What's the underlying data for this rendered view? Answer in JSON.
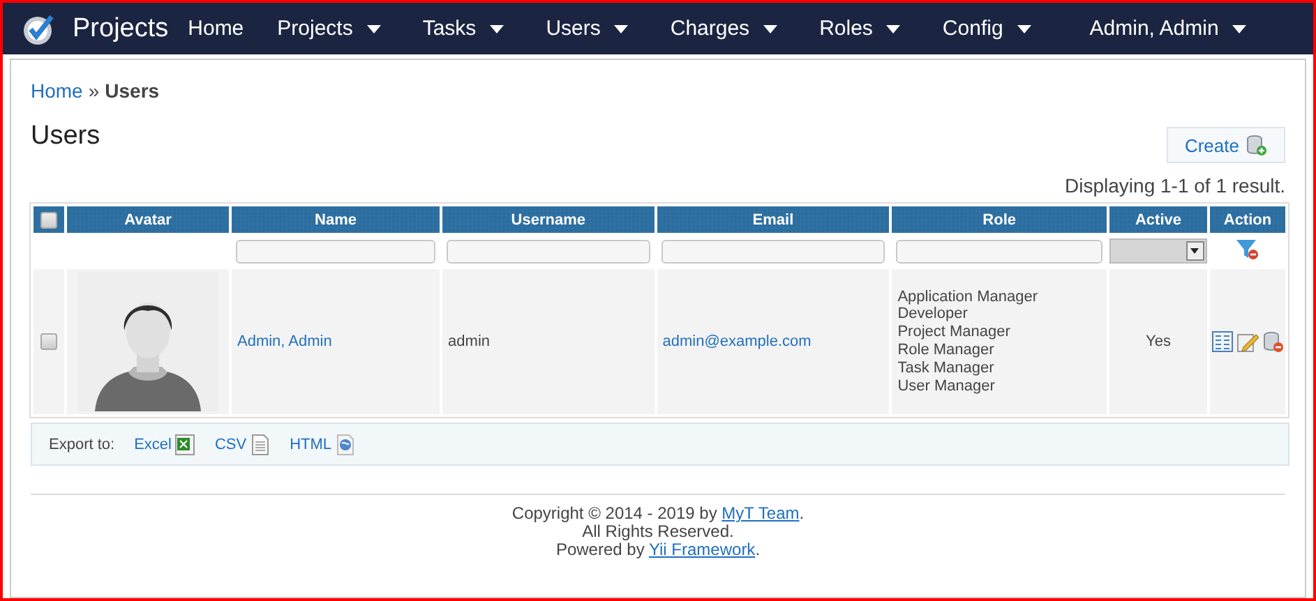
{
  "navbar": {
    "brand": "Projects",
    "items": [
      {
        "label": "Home",
        "dropdown": false
      },
      {
        "label": "Projects",
        "dropdown": true
      },
      {
        "label": "Tasks",
        "dropdown": true
      },
      {
        "label": "Users",
        "dropdown": true
      },
      {
        "label": "Charges",
        "dropdown": true
      },
      {
        "label": "Roles",
        "dropdown": true
      },
      {
        "label": "Config",
        "dropdown": true
      },
      {
        "label": "Admin, Admin",
        "dropdown": true
      }
    ]
  },
  "breadcrumb": {
    "link": "Home",
    "separator": "»",
    "current": "Users"
  },
  "page_title": "Users",
  "create_button": "Create",
  "summary": "Displaying 1-1 of 1 result.",
  "table": {
    "select_all_checked": false,
    "columns": [
      {
        "label": "Avatar"
      },
      {
        "label": "Name"
      },
      {
        "label": "Username"
      },
      {
        "label": "Email"
      },
      {
        "label": "Role"
      },
      {
        "label": "Active"
      },
      {
        "label": "Action"
      }
    ],
    "filters": [
      {
        "kind": "none"
      },
      {
        "kind": "text"
      },
      {
        "kind": "text"
      },
      {
        "kind": "text"
      },
      {
        "kind": "text"
      },
      {
        "kind": "select"
      },
      {
        "kind": "clear"
      }
    ],
    "rows": [
      {
        "checked": false,
        "avatar": {
          "kind": "picture"
        },
        "name": "Admin, Admin",
        "username": "admin",
        "email": "admin@example.com",
        "roles": [
          "Application Manager",
          "Developer",
          "Project Manager",
          "Role Manager",
          "Task Manager",
          "User Manager"
        ],
        "active": "Yes"
      }
    ]
  },
  "export": {
    "label": "Export to:",
    "links": [
      {
        "label": "Excel",
        "kind": "excel"
      },
      {
        "label": "CSV",
        "kind": "csv"
      },
      {
        "label": "HTML",
        "kind": "html"
      }
    ]
  },
  "footer": [
    {
      "before": "Copyright © 2014 - 2019 by ",
      "link": "MyT Team",
      "after": "."
    },
    {
      "before": "All Rights Reserved."
    },
    {
      "before": "Powered by ",
      "link": "Yii Framework",
      "after": "."
    }
  ]
}
